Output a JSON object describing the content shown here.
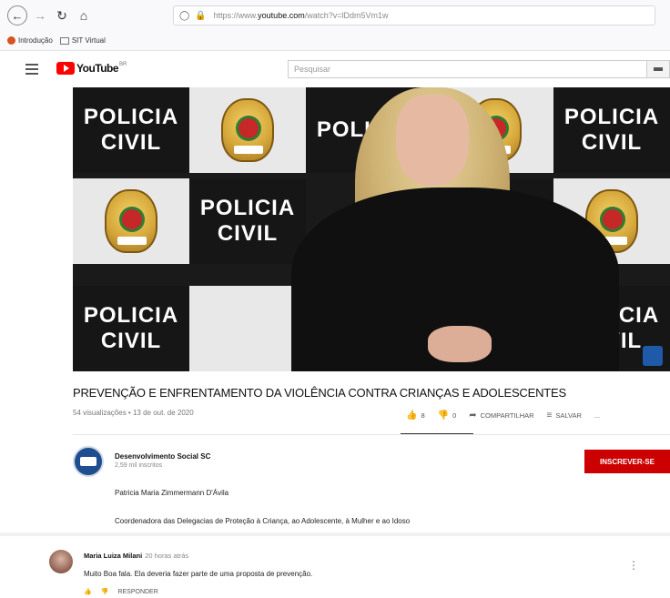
{
  "browser": {
    "back_icon": "back-arrow-icon",
    "forward_icon": "forward-arrow-icon",
    "reload_icon": "reload-icon",
    "home_icon": "home-icon",
    "url_prefix": "https://www.",
    "url_domain": "youtube.com",
    "url_path": "/watch?v=lDdm5Vm1w",
    "bookmarks": [
      "Introdução",
      "SIT Virtual"
    ]
  },
  "youtube": {
    "logo_text": "YouTube",
    "logo_sup": "BR",
    "search_placeholder": "Pesquisar"
  },
  "video": {
    "backdrop_text_line1": "POLICIA",
    "backdrop_text_line2": "CIVIL",
    "title": "PREVENÇÃO E ENFRENTAMENTO DA VIOLÊNCIA CONTRA CRIANÇAS E ADOLESCENTES",
    "meta": "54 visualizações • 13 de out. de 2020",
    "likes": "8",
    "dislikes": "0",
    "share_label": "COMPARTILHAR",
    "save_label": "SALVAR",
    "more_label": "..."
  },
  "channel": {
    "name": "Desenvolvimento Social SC",
    "subscribers": "2,59 mil inscritos",
    "subscribe_label": "INSCREVER-SE",
    "description_line1": "Patricia Maria Zimmermann D'Ávila",
    "description_line2": "Coordenadora das Delegacias de Proteção à Criança, ao Adolescente, à Mulher e ao Idoso"
  },
  "comment": {
    "author": "Maria Luiza Milani",
    "time": "20 horas atrás",
    "text": "Muito Boa fala. Ela deveria fazer parte de uma proposta de prevenção.",
    "reply_label": "RESPONDER"
  }
}
